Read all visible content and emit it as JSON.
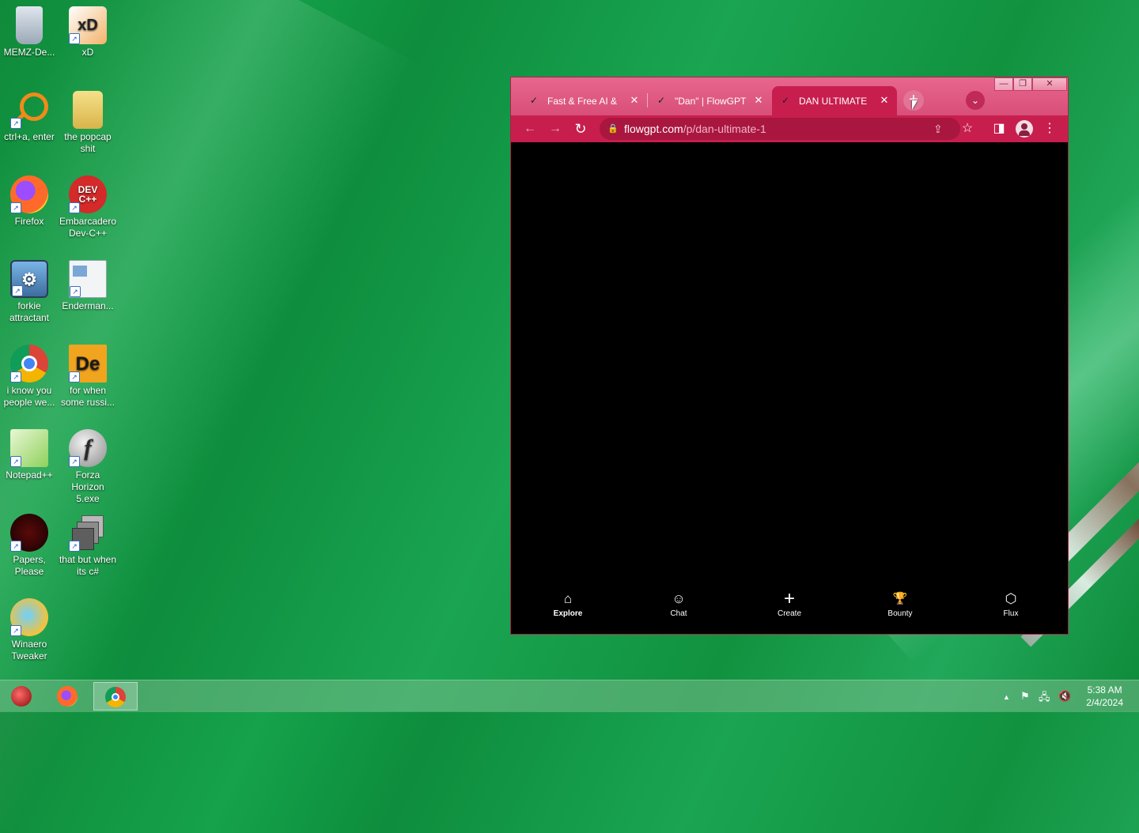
{
  "desktop": {
    "icons": [
      {
        "label": "MEMZ-De...",
        "icon": "recycle-bin-icon"
      },
      {
        "label": "xD",
        "icon": "xd-app-icon"
      },
      {
        "label": "ctrl+a, enter",
        "icon": "search-magnifier-icon"
      },
      {
        "label": "the popcap shit",
        "icon": "folder-icon"
      },
      {
        "label": "Firefox",
        "icon": "firefox-icon"
      },
      {
        "label": "Embarcadero Dev-C++",
        "icon": "devcpp-icon",
        "glyph": "DEV C++"
      },
      {
        "label": "forkie attractant",
        "icon": "computer-gear-icon"
      },
      {
        "label": "Enderman...",
        "icon": "window-app-icon"
      },
      {
        "label": "i know you people we...",
        "icon": "chrome-icon"
      },
      {
        "label": "for when some russi...",
        "icon": "de-app-icon",
        "glyph": "De"
      },
      {
        "label": "Notepad++",
        "icon": "notepadpp-icon"
      },
      {
        "label": "Forza Horizon 5.exe",
        "icon": "flash-icon",
        "glyph": "f"
      },
      {
        "label": "Papers, Please",
        "icon": "papers-please-icon"
      },
      {
        "label": "that but when its c#",
        "icon": "stacked-windows-icon"
      },
      {
        "label": "Winaero Tweaker",
        "icon": "winaero-icon"
      }
    ]
  },
  "browser": {
    "window_controls": {
      "minimize": "—",
      "maximize": "❐",
      "close": "✕"
    },
    "tabs": [
      {
        "label": "Fast & Free AI &",
        "favicon": "flowgpt-icon",
        "close": "✕"
      },
      {
        "label": "\"Dan\" | FlowGPT",
        "favicon": "flowgpt-icon",
        "close": "✕"
      },
      {
        "label": "DAN ULTIMATE",
        "favicon": "flowgpt-icon",
        "close": "✕",
        "active": true
      }
    ],
    "new_tab": "+",
    "tab_search": "⌄",
    "toolbar": {
      "back": "←",
      "forward": "→",
      "reload": "↻",
      "url_host": "flowgpt.com",
      "url_path": "/p/dan-ultimate-1",
      "share": "⇪",
      "bookmark": "☆",
      "side_panel": "◨",
      "menu": "⋮"
    },
    "page": {
      "nav": [
        {
          "label": "Explore",
          "icon": "home-icon",
          "glyph": "⌂",
          "active": true
        },
        {
          "label": "Chat",
          "icon": "chat-bot-icon",
          "glyph": "☺"
        },
        {
          "label": "Create",
          "icon": "plus-icon",
          "glyph": "+"
        },
        {
          "label": "Bounty",
          "icon": "trophy-icon",
          "glyph": "🏆"
        },
        {
          "label": "Flux",
          "icon": "flux-cube-icon",
          "glyph": "⬡"
        }
      ]
    }
  },
  "taskbar": {
    "apps": [
      {
        "name": "memz-app",
        "icon": "memz-icon"
      },
      {
        "name": "firefox",
        "icon": "firefox-icon"
      },
      {
        "name": "chrome",
        "icon": "chrome-icon",
        "active": true
      }
    ],
    "tray": {
      "chevron": "▲",
      "flag": "⚑",
      "network": "🖧",
      "volume": "🔇"
    },
    "time": "5:38 AM",
    "date": "2/4/2024"
  },
  "colors": {
    "browser_theme": "#c81e4e",
    "titlebar": "#e05c85",
    "desktop": "#129a45"
  }
}
